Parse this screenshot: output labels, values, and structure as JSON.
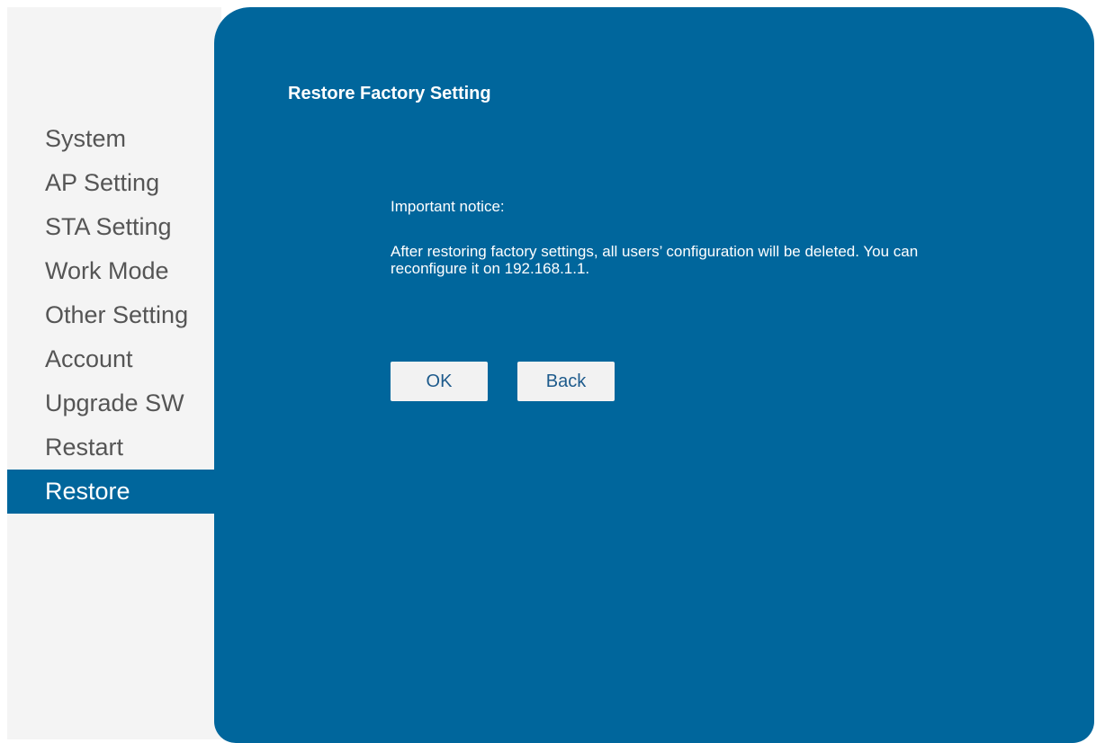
{
  "sidebar": {
    "items": [
      {
        "label": "System",
        "active": false
      },
      {
        "label": "AP Setting",
        "active": false
      },
      {
        "label": "STA Setting",
        "active": false
      },
      {
        "label": "Work Mode",
        "active": false
      },
      {
        "label": "Other Setting",
        "active": false
      },
      {
        "label": "Account",
        "active": false
      },
      {
        "label": "Upgrade SW",
        "active": false
      },
      {
        "label": "Restart",
        "active": false
      },
      {
        "label": "Restore",
        "active": true
      }
    ]
  },
  "main": {
    "title": "Restore Factory Setting",
    "notice_heading": "Important notice:",
    "notice_body": "After restoring factory settings, all users’ configuration will be deleted. You can reconfigure it on 192.168.1.1.",
    "buttons": {
      "ok_label": "OK",
      "back_label": "Back"
    }
  },
  "colors": {
    "panel_background": "#00669c",
    "sidebar_background": "#f4f4f4",
    "active_item_background": "#00669c",
    "button_text": "#1e5b8c"
  }
}
